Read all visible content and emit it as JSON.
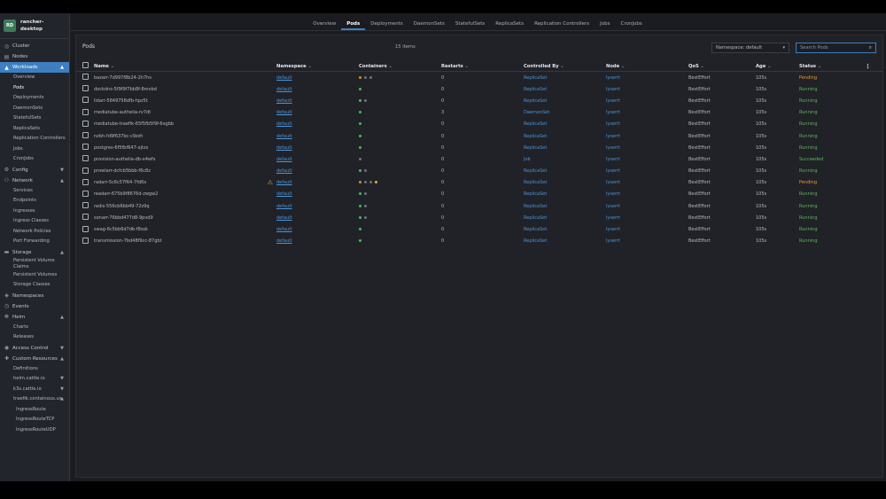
{
  "cluster": {
    "badge": "RD",
    "name": "rancher-desktop"
  },
  "sidebar": {
    "items": [
      {
        "key": "cluster",
        "label": "Cluster",
        "icon": "cluster-icon",
        "glyph": "◎",
        "children": []
      },
      {
        "key": "nodes",
        "label": "Nodes",
        "icon": "nodes-icon",
        "glyph": "▤",
        "children": []
      },
      {
        "key": "workloads",
        "label": "Workloads",
        "icon": "workloads-icon",
        "glyph": "▲",
        "active": true,
        "chev": "▲",
        "children": [
          "Overview",
          "Pods",
          "Deployments",
          "DaemonSets",
          "StatefulSets",
          "ReplicaSets",
          "Replication Controllers",
          "Jobs",
          "CronJobs"
        ]
      },
      {
        "key": "config",
        "label": "Config",
        "icon": "config-icon",
        "glyph": "⚙",
        "chev": "▼",
        "children": []
      },
      {
        "key": "network",
        "label": "Network",
        "icon": "network-icon",
        "glyph": "⚇",
        "chev": "▲",
        "children": [
          "Services",
          "Endpoints",
          "Ingresses",
          "Ingress Classes",
          "Network Policies",
          "Port Forwarding"
        ]
      },
      {
        "key": "storage",
        "label": "Storage",
        "icon": "storage-icon",
        "glyph": "▬",
        "chev": "▲",
        "children": [
          "Persistent Volume Claims",
          "Persistent Volumes",
          "Storage Classes"
        ]
      },
      {
        "key": "namespaces",
        "label": "Namespaces",
        "icon": "namespaces-icon",
        "glyph": "◈",
        "children": []
      },
      {
        "key": "events",
        "label": "Events",
        "icon": "events-icon",
        "glyph": "◷",
        "children": []
      },
      {
        "key": "helm",
        "label": "Helm",
        "icon": "helm-icon",
        "glyph": "☸",
        "chev": "▲",
        "children": [
          "Charts",
          "Releases"
        ]
      },
      {
        "key": "access",
        "label": "Access Control",
        "icon": "access-control-icon",
        "glyph": "◉",
        "chev": "▼",
        "children": []
      },
      {
        "key": "custom",
        "label": "Custom Resources",
        "icon": "puzzle-icon",
        "glyph": "✚",
        "chev": "▲",
        "children": [
          "Definitions"
        ]
      }
    ],
    "groups": [
      {
        "label": "helm.cattle.io",
        "chev": "▼"
      },
      {
        "label": "k3s.cattle.io",
        "chev": "▼"
      },
      {
        "label": "traefik.containous.us",
        "chev": "▲"
      }
    ],
    "deep_items": [
      "IngressRoute",
      "IngressRouteTCP",
      "IngressRouteUDP"
    ],
    "selected": "Pods"
  },
  "tabs": [
    "Overview",
    "Pods",
    "Deployments",
    "DaemonSets",
    "StatefulSets",
    "ReplicaSets",
    "Replication Controllers",
    "Jobs",
    "CronJobs"
  ],
  "active_tab": "Pods",
  "panel": {
    "title": "Pods",
    "count": "15 items",
    "namespace_select": "Namespace: default",
    "search_placeholder": "Search Pods"
  },
  "table": {
    "columns": [
      "Name",
      "Namespace",
      "Containers",
      "Restarts",
      "Controlled By",
      "Node",
      "QoS",
      "Age",
      "Status"
    ],
    "rows": [
      {
        "name": "bazarr-7d997f8b24-2h7hs",
        "namespace": "default",
        "containers": [
          "orange",
          "grey",
          "grey"
        ],
        "restarts": "0",
        "controlled": "ReplicaSet",
        "node": "lyserrt",
        "qos": "BestEffort",
        "age": "105s",
        "status": "Pending",
        "warn": false
      },
      {
        "name": "dockdns-5f9f9f7bb8f-8mvbd",
        "namespace": "default",
        "containers": [
          "green"
        ],
        "restarts": "0",
        "controlled": "ReplicaSet",
        "node": "lyserrt",
        "qos": "BestEffort",
        "age": "105s",
        "status": "Running",
        "warn": false
      },
      {
        "name": "lidarr-5849758dfb-hpz5t",
        "namespace": "default",
        "containers": [
          "green",
          "grey"
        ],
        "restarts": "0",
        "controlled": "ReplicaSet",
        "node": "lyserrt",
        "qos": "BestEffort",
        "age": "105s",
        "status": "Running",
        "warn": false
      },
      {
        "name": "mediatube-authelia-rv7dt",
        "namespace": "default",
        "containers": [
          "green"
        ],
        "restarts": "3",
        "controlled": "DaemonSet",
        "node": "lyserrt",
        "qos": "BestEffort",
        "age": "105s",
        "status": "Running",
        "warn": false
      },
      {
        "name": "mediatube-traefik-65f5fb5f9f-6xgbb",
        "namespace": "default",
        "containers": [
          "green"
        ],
        "restarts": "0",
        "controlled": "ReplicaSet",
        "node": "lyserrt",
        "qos": "BestEffort",
        "age": "105s",
        "status": "Running",
        "warn": false
      },
      {
        "name": "nzbh-fd9f637bc-c9zzh",
        "namespace": "default",
        "containers": [
          "green"
        ],
        "restarts": "0",
        "controlled": "ReplicaSet",
        "node": "lyserrt",
        "qos": "BestEffort",
        "age": "105s",
        "status": "Running",
        "warn": false
      },
      {
        "name": "postgres-6f5fbf647-xjtzx",
        "namespace": "default",
        "containers": [
          "green"
        ],
        "restarts": "0",
        "controlled": "ReplicaSet",
        "node": "lyserrt",
        "qos": "BestEffort",
        "age": "105s",
        "status": "Running",
        "warn": false
      },
      {
        "name": "provision-authelia-db-x4wfs",
        "namespace": "default",
        "containers": [
          "grey"
        ],
        "restarts": "0",
        "controlled": "Job",
        "node": "lyserrt",
        "qos": "BestEffort",
        "age": "105s",
        "status": "Succeeded",
        "warn": false
      },
      {
        "name": "prowlarr-dcfcb5bbb-f6c8z",
        "namespace": "default",
        "containers": [
          "green",
          "grey"
        ],
        "restarts": "0",
        "controlled": "ReplicaSet",
        "node": "lyserrt",
        "qos": "BestEffort",
        "age": "105s",
        "status": "Running",
        "warn": false
      },
      {
        "name": "radarr-5c6c57f64-7fd6x",
        "namespace": "default",
        "containers": [
          "orange",
          "grey",
          "grey",
          "yellow"
        ],
        "restarts": "0",
        "controlled": "ReplicaSet",
        "node": "lyserrt",
        "qos": "BestEffort",
        "age": "105s",
        "status": "Pending",
        "warn": true
      },
      {
        "name": "readarr-675b9f8676d-zwgw2",
        "namespace": "default",
        "containers": [
          "green",
          "grey"
        ],
        "restarts": "0",
        "controlled": "ReplicaSet",
        "node": "lyserrt",
        "qos": "BestEffort",
        "age": "105s",
        "status": "Running",
        "warn": false
      },
      {
        "name": "redis-556cb6bb49-72z9q",
        "namespace": "default",
        "containers": [
          "green",
          "grey"
        ],
        "restarts": "0",
        "controlled": "ReplicaSet",
        "node": "lyserrt",
        "qos": "BestEffort",
        "age": "105s",
        "status": "Running",
        "warn": false
      },
      {
        "name": "sonarr-76bbd477d8-9pvd9",
        "namespace": "default",
        "containers": [
          "green",
          "grey"
        ],
        "restarts": "0",
        "controlled": "ReplicaSet",
        "node": "lyserrt",
        "qos": "BestEffort",
        "age": "105s",
        "status": "Running",
        "warn": false
      },
      {
        "name": "swag-6c5bb6d7db-f8ssk",
        "namespace": "default",
        "containers": [
          "green"
        ],
        "restarts": "0",
        "controlled": "ReplicaSet",
        "node": "lyserrt",
        "qos": "BestEffort",
        "age": "105s",
        "status": "Running",
        "warn": false
      },
      {
        "name": "transmission-7bd48f9cc-87gbt",
        "namespace": "default",
        "containers": [
          "green"
        ],
        "restarts": "0",
        "controlled": "ReplicaSet",
        "node": "lyserrt",
        "qos": "BestEffort",
        "age": "105s",
        "status": "Running",
        "warn": false
      }
    ]
  },
  "colors": {
    "accent": "#3d7fc1",
    "link": "#4a95dc",
    "pending": "#e79b2c",
    "running": "#5cb85c",
    "warning": "#e3b426"
  },
  "icons": {
    "sort": "sort-icon",
    "warning": "warning-icon",
    "kebab": "kebab-menu-icon",
    "search": "search-icon"
  }
}
